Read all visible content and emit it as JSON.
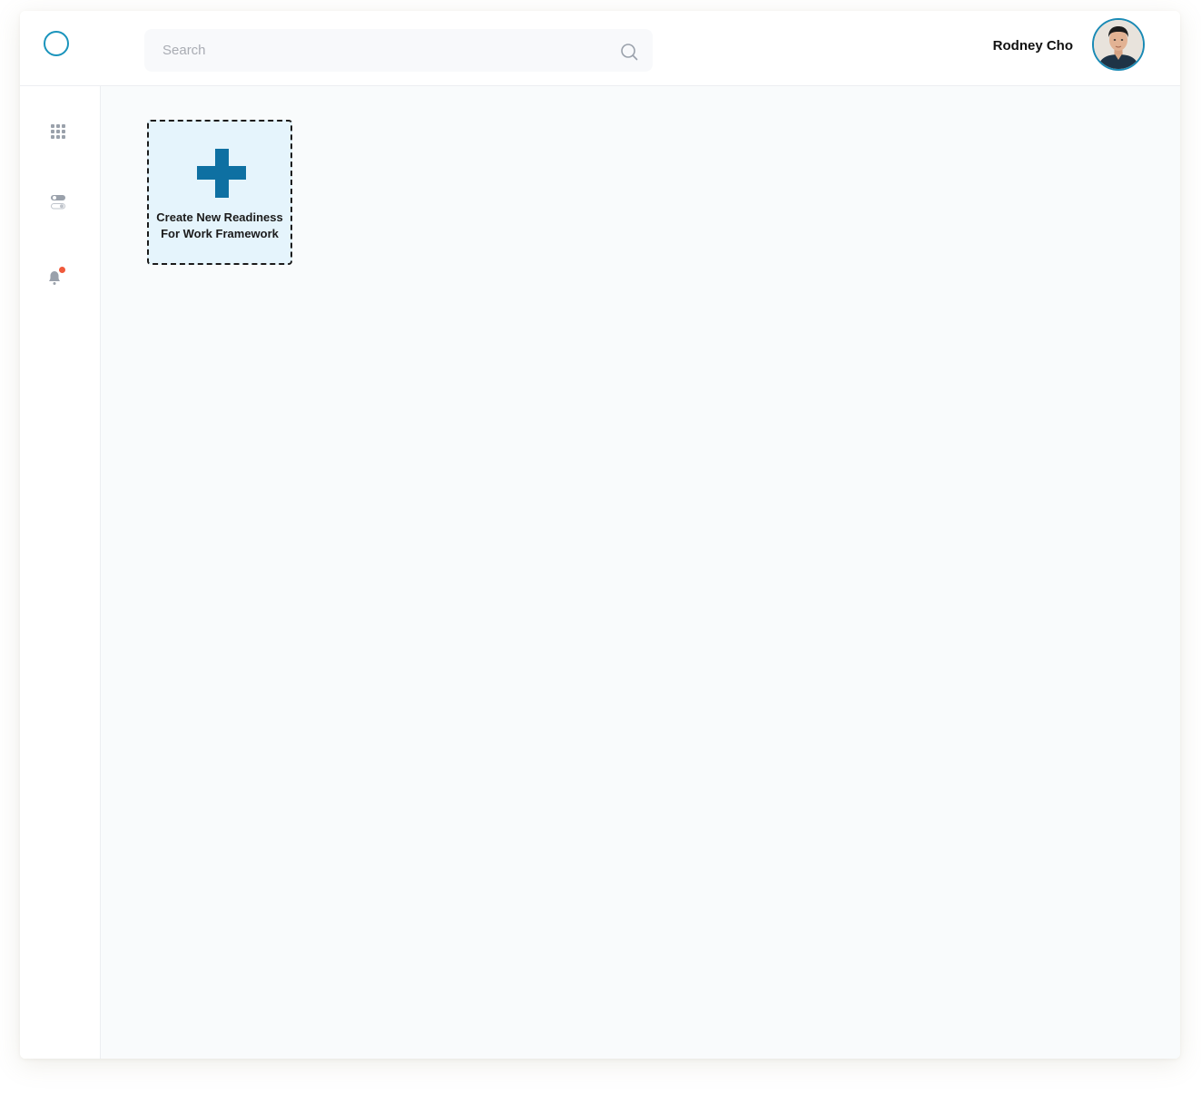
{
  "header": {
    "search_placeholder": "Search",
    "user_name": "Rodney Cho"
  },
  "sidebar": {
    "items": [
      {
        "icon": "grid-icon"
      },
      {
        "icon": "toggles-icon"
      },
      {
        "icon": "bell-icon",
        "has_notification": true
      }
    ]
  },
  "main": {
    "create_card": {
      "label": "Create New Readiness For Work Framework"
    }
  },
  "colors": {
    "accent": "#1a94bc",
    "plus": "#0e70a2",
    "card_bg": "#e5f4fc",
    "notification_dot": "#f05a3c",
    "icon_gray": "#9aa1ab"
  }
}
